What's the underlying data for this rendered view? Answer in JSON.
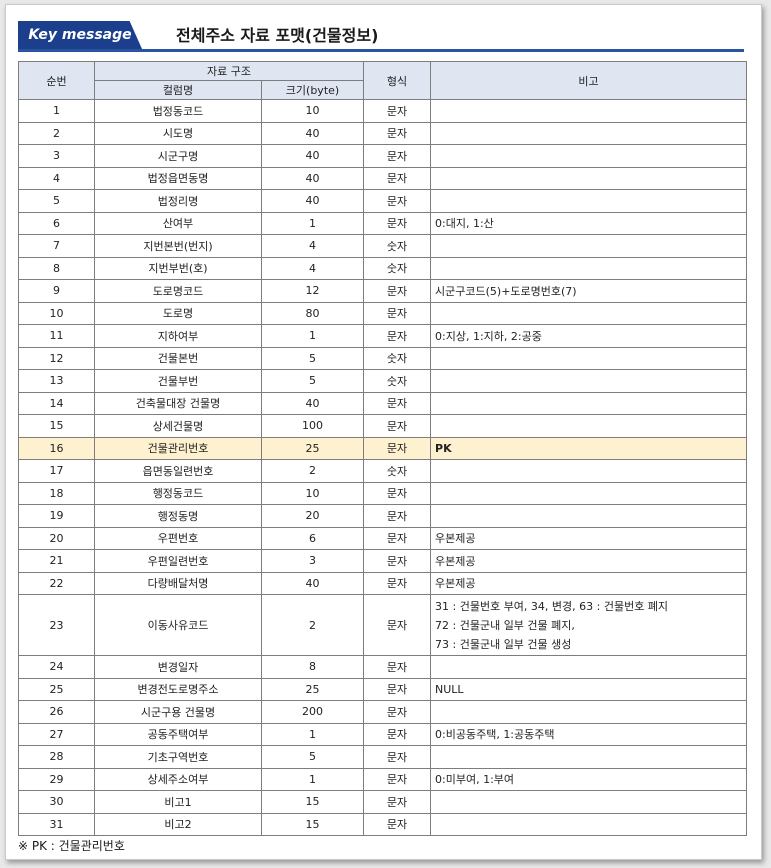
{
  "header": {
    "key_label": "Key message",
    "title": "전체주소 자료 포맷(건물정보)"
  },
  "table": {
    "headers": {
      "seq": "순번",
      "structure": "자료 구조",
      "column_name": "컬럼명",
      "size": "크기(byte)",
      "format": "형식",
      "note": "비고"
    },
    "rows": [
      {
        "seq": "1",
        "name": "법정동코드",
        "size": "10",
        "format": "문자",
        "note": ""
      },
      {
        "seq": "2",
        "name": "시도명",
        "size": "40",
        "format": "문자",
        "note": ""
      },
      {
        "seq": "3",
        "name": "시군구명",
        "size": "40",
        "format": "문자",
        "note": ""
      },
      {
        "seq": "4",
        "name": "법정읍면동명",
        "size": "40",
        "format": "문자",
        "note": ""
      },
      {
        "seq": "5",
        "name": "법정리명",
        "size": "40",
        "format": "문자",
        "note": ""
      },
      {
        "seq": "6",
        "name": "산여부",
        "size": "1",
        "format": "문자",
        "note": "0:대지, 1:산"
      },
      {
        "seq": "7",
        "name": "지번본번(번지)",
        "size": "4",
        "format": "숫자",
        "note": ""
      },
      {
        "seq": "8",
        "name": "지번부번(호)",
        "size": "4",
        "format": "숫자",
        "note": ""
      },
      {
        "seq": "9",
        "name": "도로명코드",
        "size": "12",
        "format": "문자",
        "note": "시군구코드(5)+도로명번호(7)"
      },
      {
        "seq": "10",
        "name": "도로명",
        "size": "80",
        "format": "문자",
        "note": ""
      },
      {
        "seq": "11",
        "name": "지하여부",
        "size": "1",
        "format": "문자",
        "note": "0:지상, 1:지하, 2:공중"
      },
      {
        "seq": "12",
        "name": "건물본번",
        "size": "5",
        "format": "숫자",
        "note": ""
      },
      {
        "seq": "13",
        "name": "건물부번",
        "size": "5",
        "format": "숫자",
        "note": ""
      },
      {
        "seq": "14",
        "name": "건축물대장 건물명",
        "size": "40",
        "format": "문자",
        "note": ""
      },
      {
        "seq": "15",
        "name": "상세건물명",
        "size": "100",
        "format": "문자",
        "note": ""
      },
      {
        "seq": "16",
        "name": "건물관리번호",
        "size": "25",
        "format": "문자",
        "note": "PK"
      },
      {
        "seq": "17",
        "name": "읍면동일련번호",
        "size": "2",
        "format": "숫자",
        "note": ""
      },
      {
        "seq": "18",
        "name": "행정동코드",
        "size": "10",
        "format": "문자",
        "note": ""
      },
      {
        "seq": "19",
        "name": "행정동명",
        "size": "20",
        "format": "문자",
        "note": ""
      },
      {
        "seq": "20",
        "name": "우편번호",
        "size": "6",
        "format": "문자",
        "note": "우본제공"
      },
      {
        "seq": "21",
        "name": "우편일련번호",
        "size": "3",
        "format": "문자",
        "note": "우본제공"
      },
      {
        "seq": "22",
        "name": "다량배달처명",
        "size": "40",
        "format": "문자",
        "note": "우본제공"
      },
      {
        "seq": "23",
        "name": "이동사유코드",
        "size": "2",
        "format": "문자",
        "note": "31 : 건물번호 부여, 34, 변경, 63 : 건물번호 폐지",
        "note2": "72 : 건물군내 일부 건물 폐지,",
        "note3": "73 : 건물군내 일부 건물 생성"
      },
      {
        "seq": "24",
        "name": "변경일자",
        "size": "8",
        "format": "문자",
        "note": ""
      },
      {
        "seq": "25",
        "name": "변경전도로명주소",
        "size": "25",
        "format": "문자",
        "note": "NULL"
      },
      {
        "seq": "26",
        "name": "시군구용 건물명",
        "size": "200",
        "format": "문자",
        "note": ""
      },
      {
        "seq": "27",
        "name": "공동주택여부",
        "size": "1",
        "format": "문자",
        "note": "0:비공동주택, 1:공동주택"
      },
      {
        "seq": "28",
        "name": "기초구역번호",
        "size": "5",
        "format": "문자",
        "note": ""
      },
      {
        "seq": "29",
        "name": "상세주소여부",
        "size": "1",
        "format": "문자",
        "note": "0:미부여, 1:부여"
      },
      {
        "seq": "30",
        "name": "비고1",
        "size": "15",
        "format": "문자",
        "note": ""
      },
      {
        "seq": "31",
        "name": "비고2",
        "size": "15",
        "format": "문자",
        "note": ""
      }
    ]
  },
  "footnote": "※ PK : 건물관리번호",
  "colors": {
    "accent": "#1b3f8c",
    "header_fill": "#dfe6f2",
    "highlight_fill": "#fdf1d0"
  }
}
